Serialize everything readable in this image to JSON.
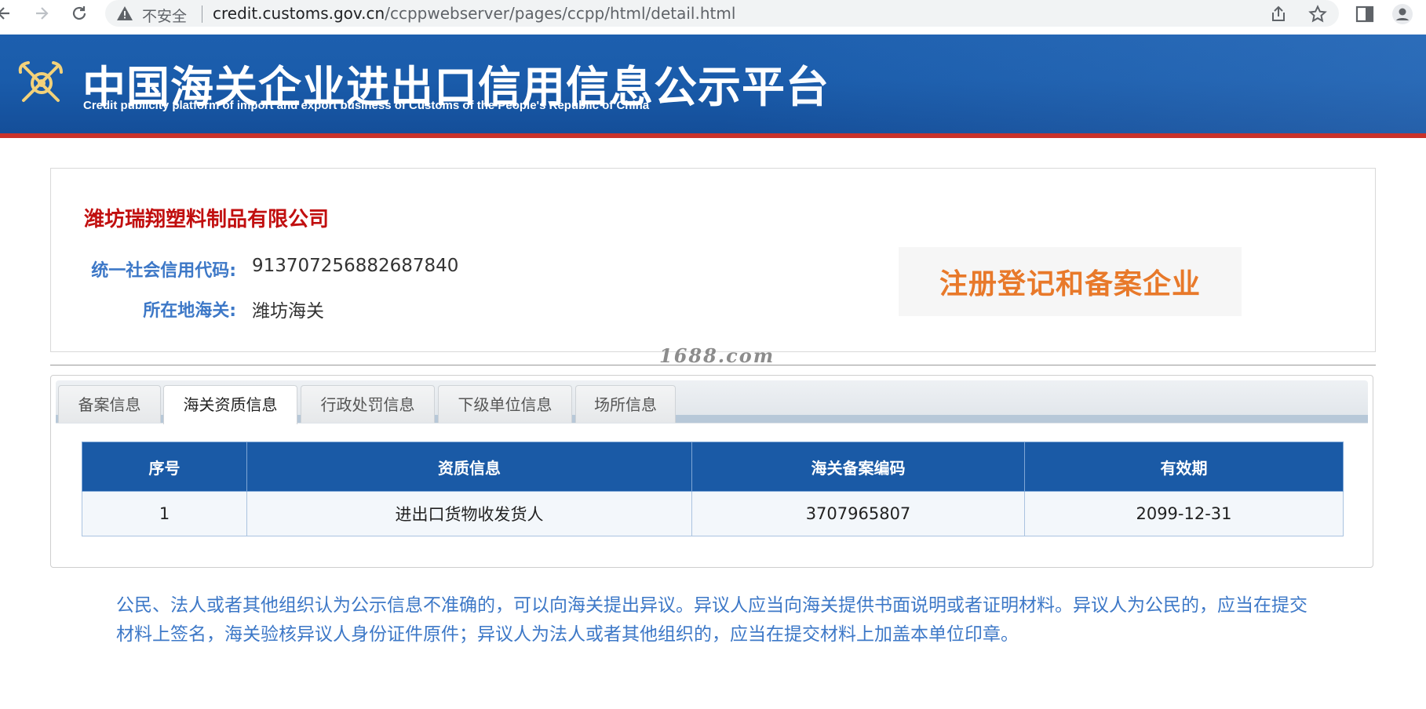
{
  "browser": {
    "security_label": "不安全",
    "url_host": "credit.customs.gov.cn",
    "url_path": "/ccppwebserver/pages/ccpp/html/detail.html"
  },
  "header": {
    "title": "中国海关企业进出口信用信息公示平台",
    "subtitle": "Credit publicity platform of import and export business of Customs of the People's Republic of China"
  },
  "company": {
    "name": "潍坊瑞翔塑料制品有限公司",
    "credit_code_label": "统一社会信用代码:",
    "credit_code": "913707256882687840",
    "customs_label": "所在地海关:",
    "customs": "潍坊海关",
    "status_badge": "注册登记和备案企业"
  },
  "watermark": "1688.com",
  "tabs": [
    {
      "label": "备案信息",
      "active": false
    },
    {
      "label": "海关资质信息",
      "active": true
    },
    {
      "label": "行政处罚信息",
      "active": false
    },
    {
      "label": "下级单位信息",
      "active": false
    },
    {
      "label": "场所信息",
      "active": false
    }
  ],
  "qualification_table": {
    "columns": [
      "序号",
      "资质信息",
      "海关备案编码",
      "有效期"
    ],
    "rows": [
      [
        "1",
        "进出口货物收发货人",
        "3707965807",
        "2099-12-31"
      ]
    ]
  },
  "notice": "公民、法人或者其他组织认为公示信息不准确的，可以向海关提出异议。异议人应当向海关提供书面说明或者证明材料。异议人为公民的，应当在提交材料上签名，海关验核异议人身份证件原件；异议人为法人或者其他组织的，应当在提交材料上加盖本单位印章。",
  "colors": {
    "banner": "#1a5cab",
    "company_name": "#c10f0f",
    "label_blue": "#3d78c7",
    "badge_orange": "#e8792a",
    "table_header": "#1a5aa6"
  }
}
